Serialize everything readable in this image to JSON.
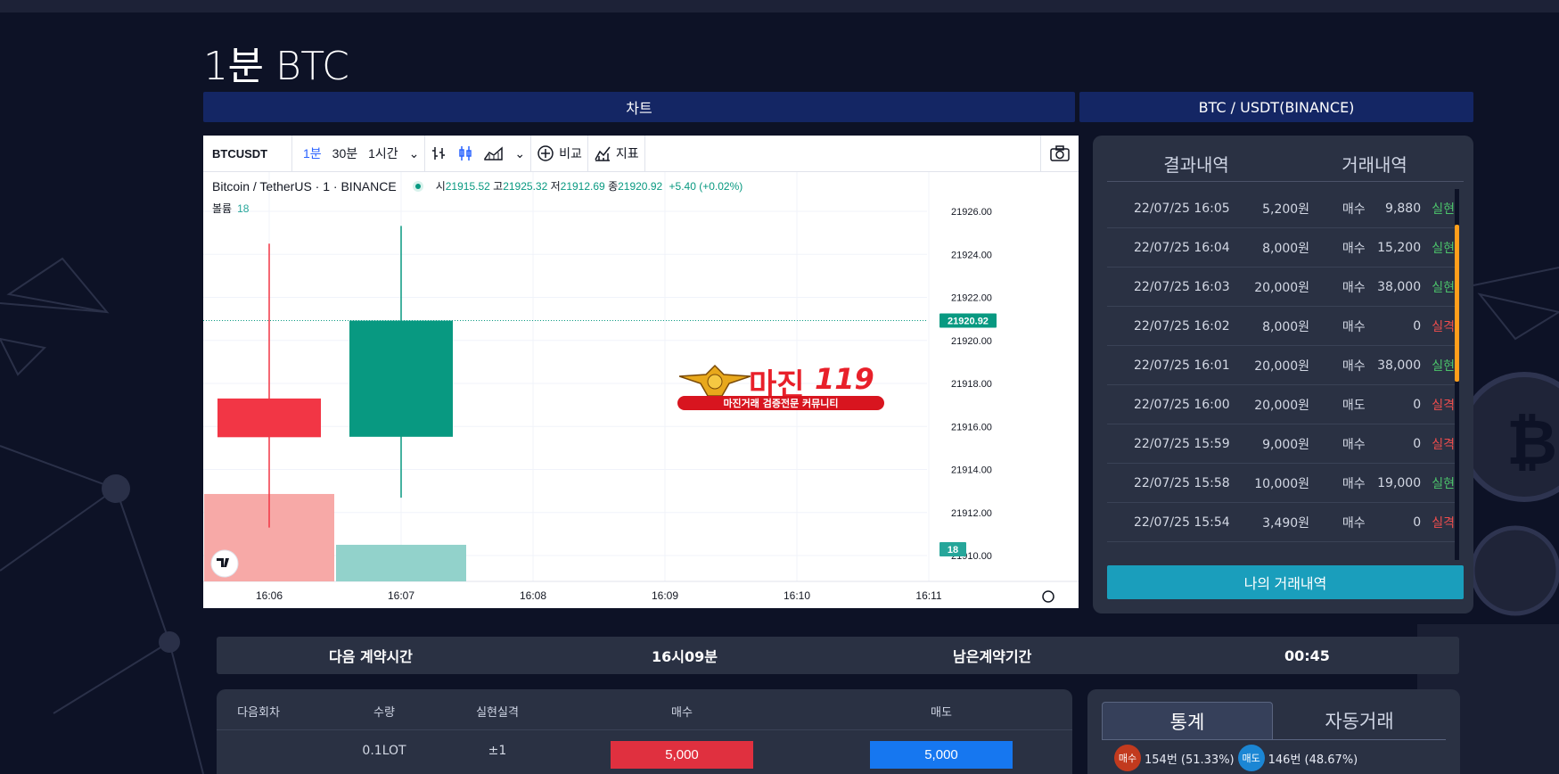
{
  "page": {
    "title": "1분 BTC"
  },
  "section_tabs": {
    "chart": "차트",
    "pair": "BTC / USDT(BINANCE)"
  },
  "chart_toolbar": {
    "symbol": "BTCUSDT",
    "intervals": [
      "1분",
      "30분",
      "1시간"
    ],
    "active_interval": "1분",
    "compare_label": "비교",
    "indicators_label": "지표"
  },
  "chart_legend": {
    "name": "Bitcoin / TetherUS · 1 · BINANCE",
    "open_label": "시",
    "open": "21915.52",
    "high_label": "고",
    "high": "21925.32",
    "low_label": "저",
    "low": "21912.69",
    "close_label": "종",
    "close": "21920.92",
    "change": "+5.40 (+0.02%)",
    "volume_label": "볼륨",
    "volume": "18"
  },
  "chart_data": {
    "type": "candlestick",
    "x": [
      "16:06",
      "16:07",
      "16:08",
      "16:09",
      "16:10",
      "16:11"
    ],
    "candles": [
      {
        "time": "16:06",
        "open": 21917.3,
        "high": 21924.5,
        "low": 21911.3,
        "close": 21915.5,
        "volume": 43
      },
      {
        "time": "16:07",
        "open": 21915.52,
        "high": 21925.32,
        "low": 21912.69,
        "close": 21920.92,
        "volume": 18
      }
    ],
    "ylim": [
      21910,
      21926
    ],
    "yticks": [
      "21926.00",
      "21924.00",
      "21922.00",
      "21920.00",
      "21918.00",
      "21916.00",
      "21914.00",
      "21912.00",
      "21910.00"
    ],
    "last_price_label": "21920.92",
    "last_volume_label": "18",
    "up_color": "#089981",
    "down_color": "#f23645",
    "grid": true
  },
  "watermark": {
    "main": "마진",
    "num": "119",
    "sub": "마진거래 검증전문 커뮤니티"
  },
  "results": {
    "tabs": [
      "결과내역",
      "거래내역"
    ],
    "rows": [
      {
        "time": "22/07/25 16:05",
        "amount": "5,200원",
        "side": "매수",
        "profit": "9,880",
        "status": "실현"
      },
      {
        "time": "22/07/25 16:04",
        "amount": "8,000원",
        "side": "매수",
        "profit": "15,200",
        "status": "실현"
      },
      {
        "time": "22/07/25 16:03",
        "amount": "20,000원",
        "side": "매수",
        "profit": "38,000",
        "status": "실현"
      },
      {
        "time": "22/07/25 16:02",
        "amount": "8,000원",
        "side": "매수",
        "profit": "0",
        "status": "실격"
      },
      {
        "time": "22/07/25 16:01",
        "amount": "20,000원",
        "side": "매수",
        "profit": "38,000",
        "status": "실현"
      },
      {
        "time": "22/07/25 16:00",
        "amount": "20,000원",
        "side": "매도",
        "profit": "0",
        "status": "실격"
      },
      {
        "time": "22/07/25 15:59",
        "amount": "9,000원",
        "side": "매수",
        "profit": "0",
        "status": "실격"
      },
      {
        "time": "22/07/25 15:58",
        "amount": "10,000원",
        "side": "매수",
        "profit": "19,000",
        "status": "실현"
      },
      {
        "time": "22/07/25 15:54",
        "amount": "3,490원",
        "side": "매수",
        "profit": "0",
        "status": "실격"
      }
    ],
    "button": "나의 거래내역",
    "win_color": "#4cc46b",
    "loss_color": "#ef4d4d"
  },
  "contract": {
    "next_label": "다음 계약시간",
    "next_value": "16시09분",
    "remain_label": "남은계약기간",
    "remain_value": "00:45"
  },
  "order": {
    "headers": [
      "다음회차",
      "수량",
      "실현실격",
      "매수",
      "매도"
    ],
    "qty": "0.1LOT",
    "ratio": "±1",
    "buy": "5,000",
    "sell": "5,000"
  },
  "stats": {
    "tabs": [
      "통계",
      "자동거래"
    ],
    "buy_badge": "매수",
    "buy_text": "154번 (51.33%)",
    "sell_badge": "매도",
    "sell_text": "146번 (48.67%)"
  }
}
